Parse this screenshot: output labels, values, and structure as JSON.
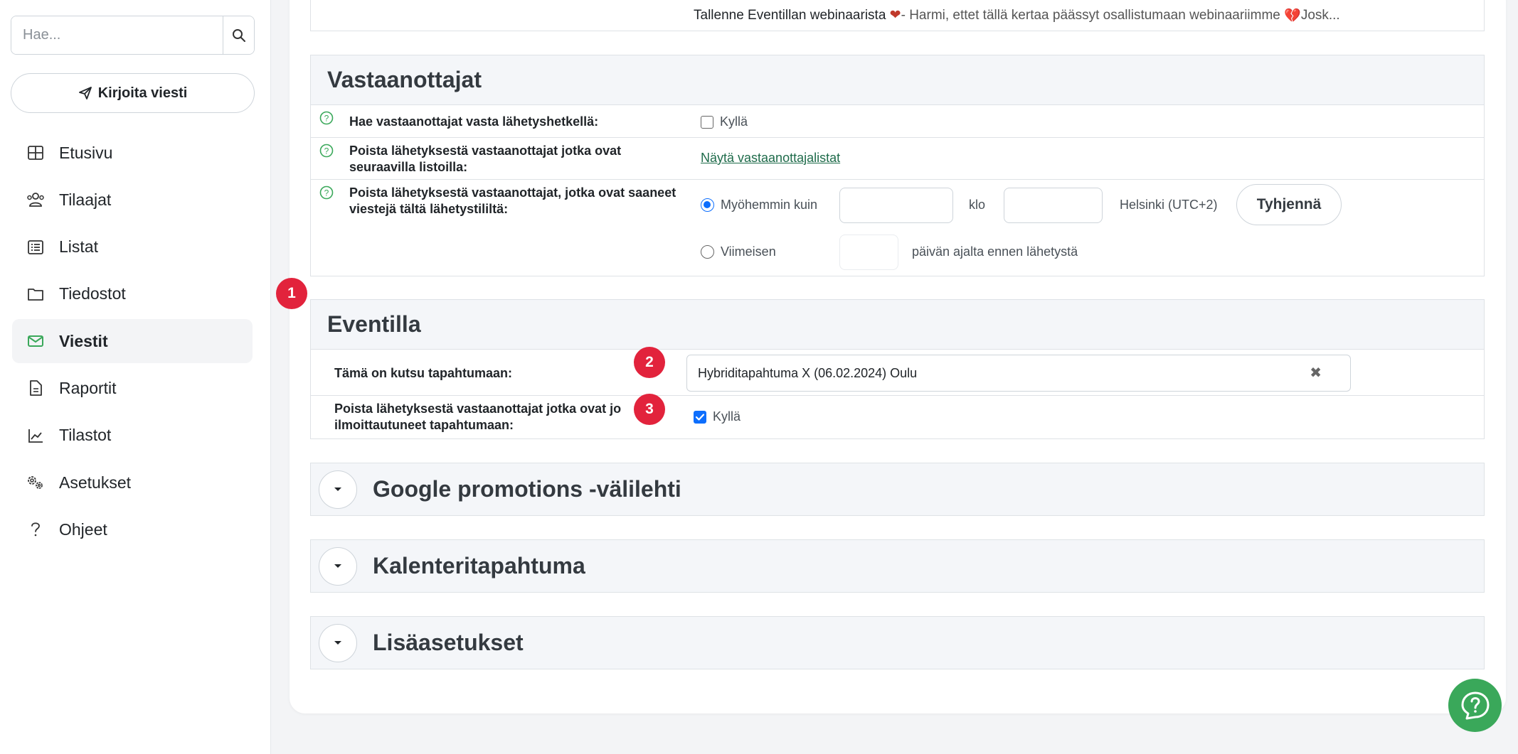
{
  "sidebar": {
    "search": {
      "placeholder": "Hae..."
    },
    "compose_label": "Kirjoita viesti",
    "items": [
      {
        "label": "Etusivu",
        "icon": "grid-icon"
      },
      {
        "label": "Tilaajat",
        "icon": "users-icon"
      },
      {
        "label": "Listat",
        "icon": "list-icon"
      },
      {
        "label": "Tiedostot",
        "icon": "folder-icon"
      },
      {
        "label": "Viestit",
        "icon": "envelope-icon",
        "active": true
      },
      {
        "label": "Raportit",
        "icon": "document-icon"
      },
      {
        "label": "Tilastot",
        "icon": "chart-icon"
      },
      {
        "label": "Asetukset",
        "icon": "gears-icon"
      },
      {
        "label": "Ohjeet",
        "icon": "question-icon"
      }
    ]
  },
  "message_preview": {
    "subject": "Tallenne Eventillan webinaarista",
    "preheader": " - Harmi, ettet tällä kertaa päässyt osallistumaan webinaariimme",
    "tail": " Josk..."
  },
  "recipients": {
    "title": "Vastaanottajat",
    "row1": {
      "label": "Hae vastaanottajat vasta lähetyshetkellä:",
      "checkbox_label": "Kyllä",
      "checked": false
    },
    "row2": {
      "label": "Poista lähetyksestä vastaanottajat jotka ovat seuraavilla listoilla:",
      "link": "Näytä vastaanottajalistat"
    },
    "row3": {
      "label": "Poista lähetyksestä vastaanottajat, jotka ovat saaneet viestejä tältä lähetystililtä:",
      "option1": "Myöhemmin kuin",
      "time_label": "klo",
      "timezone": "Helsinki (UTC+2)",
      "clear_button": "Tyhjennä",
      "option2": "Viimeisen",
      "days_suffix": "päivän ajalta ennen lähetystä",
      "selected": "option1"
    }
  },
  "eventilla": {
    "title": "Eventilla",
    "invite_label": "Tämä on kutsu tapahtumaan:",
    "event_value": "Hybriditapahtuma X (06.02.2024) Oulu",
    "remove_label": "Poista lähetyksestä vastaanottajat jotka ovat jo ilmoittautuneet tapahtumaan:",
    "remove_checkbox_label": "Kyllä",
    "remove_checked": true
  },
  "badges": [
    "1",
    "2",
    "3"
  ],
  "collapsibles": [
    {
      "title": "Google promotions -välilehti"
    },
    {
      "title": "Kalenteritapahtuma"
    },
    {
      "title": "Lisäasetukset"
    }
  ],
  "colors": {
    "accent": "#0d6efd",
    "badge": "#e2233c",
    "help_fab": "#3aa85a",
    "active_icon": "#3aa85a"
  }
}
